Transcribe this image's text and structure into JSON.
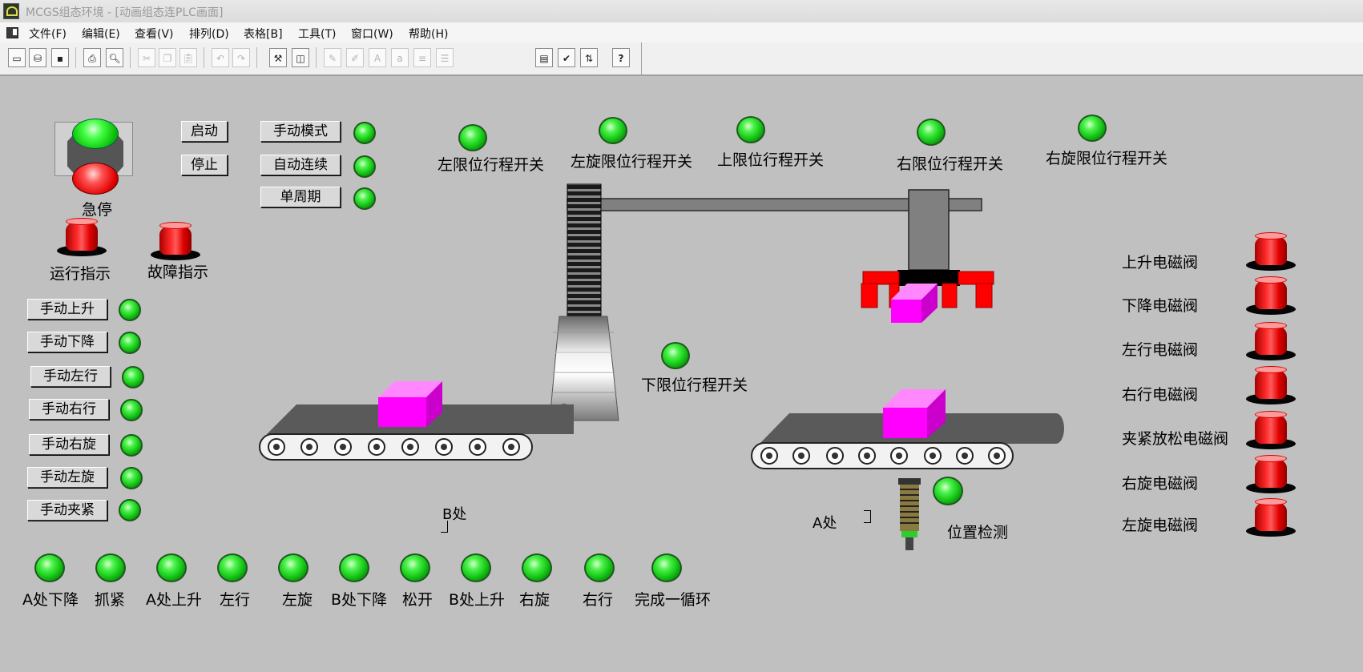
{
  "window": {
    "title": "MCGS组态环境 - [动画组态连PLC画面]"
  },
  "menu": [
    "文件(F)",
    "编辑(E)",
    "查看(V)",
    "排列(D)",
    "表格[B]",
    "工具(T)",
    "窗口(W)",
    "帮助(H)"
  ],
  "toolbar": {
    "help_glyph": "?"
  },
  "emergency": {
    "label": "急停"
  },
  "control_buttons": {
    "start": "启动",
    "stop": "停止"
  },
  "modes": [
    {
      "label": "手动模式"
    },
    {
      "label": "自动连续"
    },
    {
      "label": "单周期"
    }
  ],
  "indicators": {
    "run": "运行指示",
    "fault": "故障指示"
  },
  "manual_buttons": [
    {
      "label": "手动上升"
    },
    {
      "label": "手动下降"
    },
    {
      "label": "手动左行"
    },
    {
      "label": "手动右行"
    },
    {
      "label": "手动右旋"
    },
    {
      "label": "手动左旋"
    },
    {
      "label": "手动夹紧"
    }
  ],
  "limit_switches": {
    "left": "左限位行程开关",
    "left_rotate": "左旋限位行程开关",
    "upper": "上限位行程开关",
    "right": "右限位行程开关",
    "right_rotate": "右旋限位行程开关",
    "lower": "下限位行程开关"
  },
  "stations": {
    "b": "B处",
    "a": "A处"
  },
  "sensor": {
    "label": "位置检测"
  },
  "valves": [
    {
      "label": "上升电磁阀"
    },
    {
      "label": "下降电磁阀"
    },
    {
      "label": "左行电磁阀"
    },
    {
      "label": "右行电磁阀"
    },
    {
      "label": "夹紧放松电磁阀"
    },
    {
      "label": "右旋电磁阀"
    },
    {
      "label": "左旋电磁阀"
    }
  ],
  "sequence": [
    {
      "label": "A处下降"
    },
    {
      "label": "抓紧"
    },
    {
      "label": "A处上升"
    },
    {
      "label": "左行"
    },
    {
      "label": "左旋"
    },
    {
      "label": "B处下降"
    },
    {
      "label": "松开"
    },
    {
      "label": "B处上升"
    },
    {
      "label": "右旋"
    },
    {
      "label": "右行"
    },
    {
      "label": "完成一循环"
    }
  ],
  "colors": {
    "lamp_green": "#17c917",
    "beacon_red": "#ff2a2a",
    "workpiece_magenta": "#ff00ff",
    "gripper_red": "#ff0000",
    "belt_gray": "#5a5a5a",
    "background": "#c0c0c0"
  }
}
